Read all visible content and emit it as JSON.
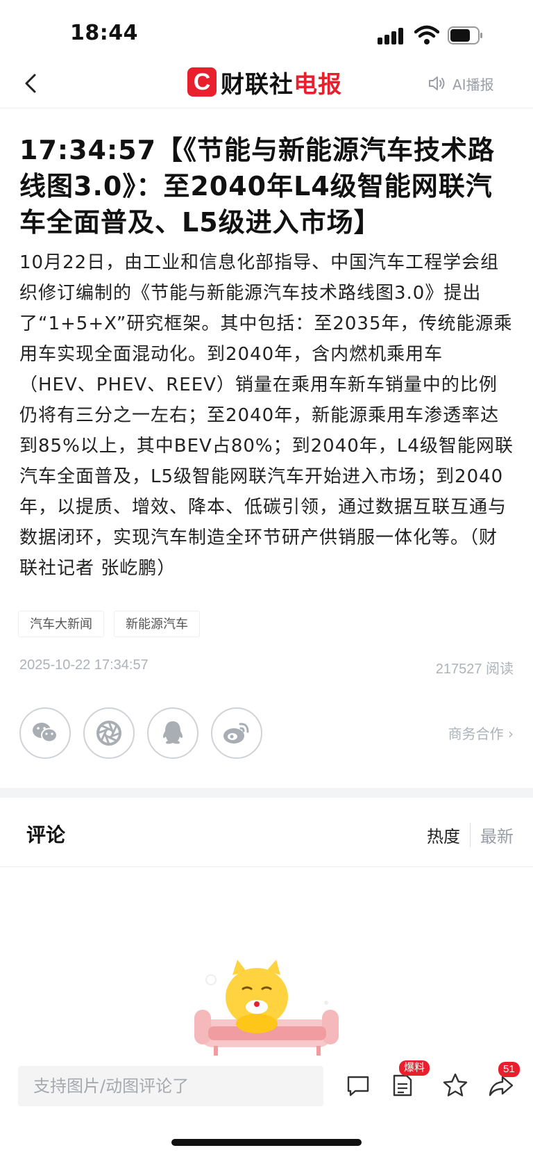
{
  "status": {
    "time": "18:44"
  },
  "nav": {
    "logo_letter": "C",
    "logo_black": "财联社",
    "logo_red": "电报",
    "ai_label": "AI播报"
  },
  "article": {
    "headline": "17:34:57【《节能与新能源汽车技术路线图3.0》：至2040年L4级智能网联汽车全面普及、L5级进入市场】",
    "body": "10月22日，由工业和信息化部指导、中国汽车工程学会组织修订编制的《节能与新能源汽车技术路线图3.0》提出了“1+5+X”研究框架。其中包括：至2035年，传统能源乘用车实现全面混动化。到2040年，含内燃机乘用车（HEV、PHEV、REEV）销量在乘用车新车销量中的比例仍将有三分之一左右；至2040年，新能源乘用车渗透率达到85%以上，其中BEV占80%；到2040年，L4级智能网联汽车全面普及，L5级智能网联汽车开始进入市场；到2040年，以提质、增效、降本、低碳引领，通过数据互联互通与数据闭环，实现汽车制造全环节研产供销服一体化等。（财联社记者 张屹鹏）",
    "tags": [
      "汽车大新闻",
      "新能源汽车"
    ],
    "date": "2025-10-22 17:34:57",
    "reads": "217527 阅读"
  },
  "share": {
    "icons": [
      "wechat-icon",
      "moments-icon",
      "qq-icon",
      "weibo-icon"
    ],
    "biz_label": "商务合作 ›"
  },
  "comments": {
    "title": "评论",
    "sort_hot": "热度",
    "sort_new": "最新"
  },
  "bottom": {
    "input_placeholder": "支持图片/动图评论了",
    "baoliao_badge": "爆料",
    "share_count": "51"
  },
  "colors": {
    "brand_red": "#e8202e",
    "muted_gray": "#aeb2b9"
  }
}
